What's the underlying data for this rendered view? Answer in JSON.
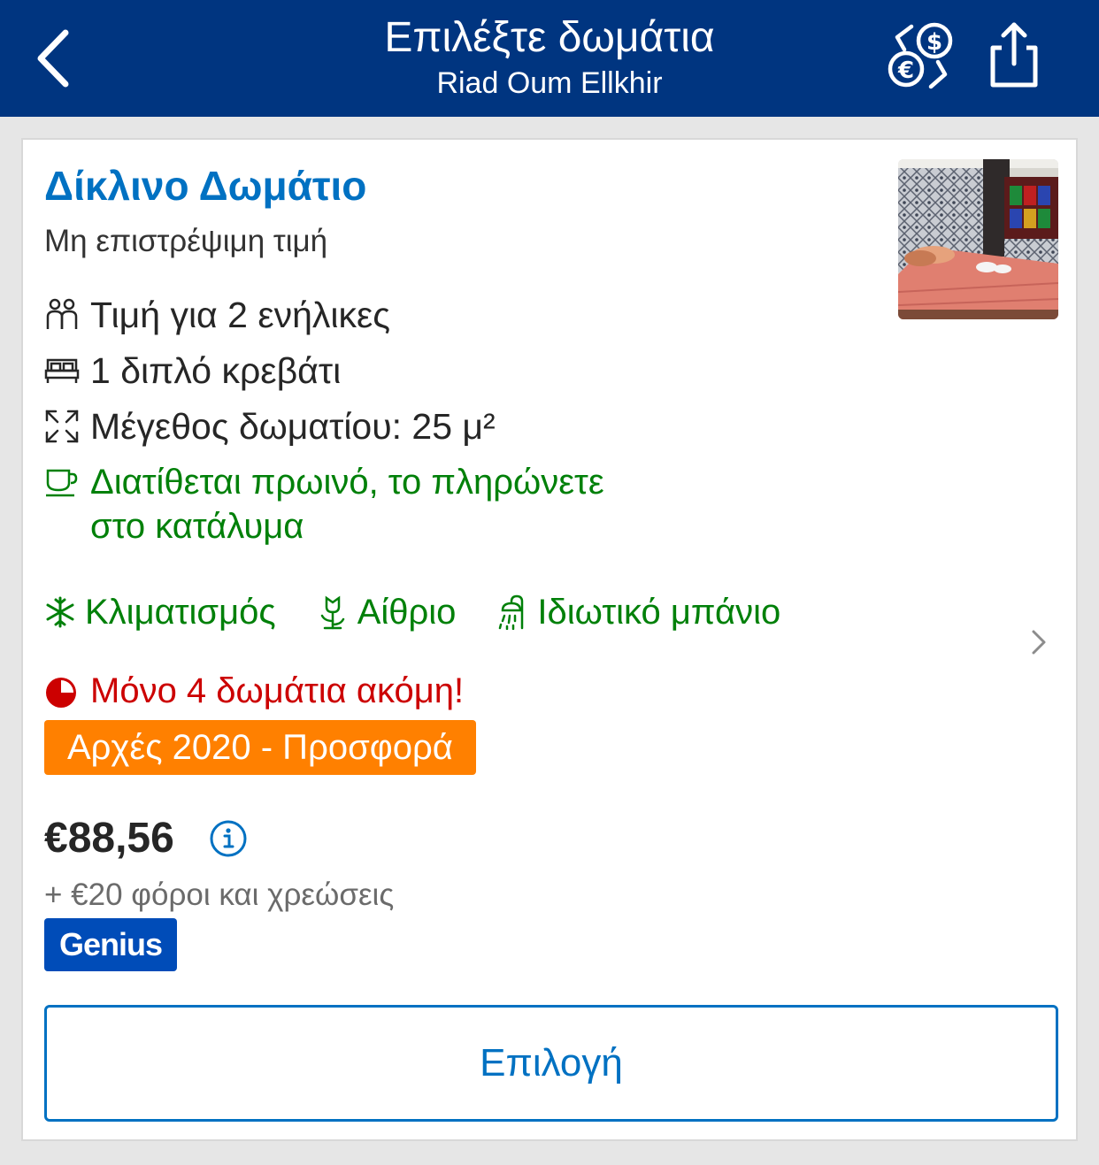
{
  "header": {
    "title": "Επιλέξτε δωμάτια",
    "subtitle": "Riad Oum Ellkhir",
    "back_icon": "chevron-left-icon",
    "currency_icon": "currency-exchange-icon",
    "share_icon": "share-icon",
    "background_color": "#003580"
  },
  "room": {
    "name": "Δίκλινο Δωμάτιο",
    "rate_policy": "Μη επιστρέψιμη τιμή",
    "features": [
      {
        "icon": "guests-icon",
        "text": "Τιμή για 2 ενήλικες"
      },
      {
        "icon": "bed-icon",
        "text": "1 διπλό κρεβάτι"
      },
      {
        "icon": "room-size-icon",
        "text": "Μέγεθος δωματίου: 25 μ²"
      }
    ],
    "breakfast": {
      "icon": "coffee-cup-icon",
      "line1": "Διατίθεται πρωινό, το πληρώνετε",
      "line2": "στο κατάλυμα"
    },
    "facilities": [
      {
        "icon": "snowflake-icon",
        "text": "Κλιματισμός"
      },
      {
        "icon": "flower-icon",
        "text": "Αίθριο"
      },
      {
        "icon": "shower-icon",
        "text": "Ιδιωτικό μπάνιο"
      }
    ],
    "scarcity": "Μόνο 4 δωμάτια ακόμη!",
    "deal": "Αρχές 2020 - Προσφορά",
    "price": "€88,56",
    "taxes": "+ €20 φόροι και χρεώσεις",
    "genius_label": "Genius",
    "select_label": "Επιλογή"
  },
  "colors": {
    "brand_blue": "#003580",
    "link_blue": "#0071c2",
    "green": "#008009",
    "red": "#cc0000",
    "deal_orange": "#ff8000",
    "genius_blue": "#004cb8"
  }
}
